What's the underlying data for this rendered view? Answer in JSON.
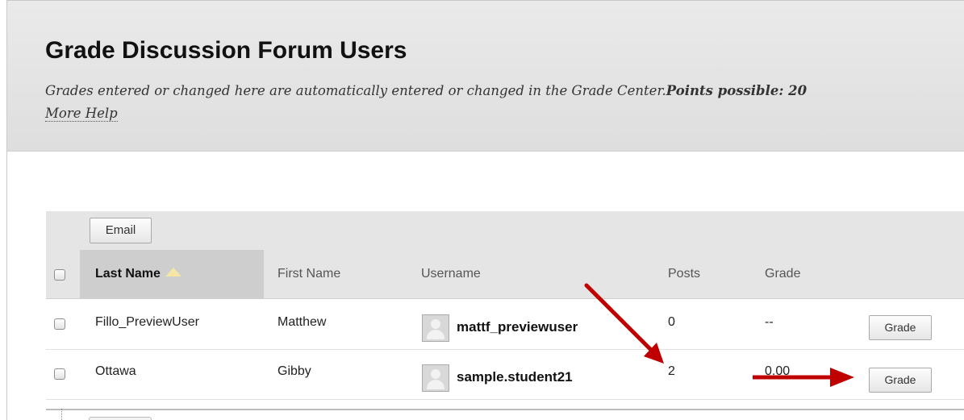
{
  "header": {
    "title": "Grade Discussion Forum Users",
    "instructions": "Grades entered or changed here are automatically entered or changed in the Grade Center.",
    "points_possible": "Points possible: 20",
    "more_help": "More Help"
  },
  "toolbar": {
    "email_label": "Email"
  },
  "table": {
    "columns": [
      "Last Name",
      "First Name",
      "Username",
      "Posts",
      "Grade"
    ],
    "rows": [
      {
        "last_name": "Fillo_PreviewUser",
        "first_name": "Matthew",
        "username": "mattf_previewuser",
        "posts": "0",
        "grade": "--",
        "action": "Grade"
      },
      {
        "last_name": "Ottawa",
        "first_name": "Gibby",
        "username": "sample.student21",
        "posts": "2",
        "grade": "0.00",
        "action": "Grade"
      }
    ]
  },
  "icons": {
    "sort": "sort-ascending-icon",
    "avatar": "user-avatar-icon",
    "annotation": "arrow-icon"
  },
  "colors": {
    "annotation_arrow": "#c00000",
    "header_band": "#e5e5e5",
    "sorted_column": "#cecece"
  }
}
